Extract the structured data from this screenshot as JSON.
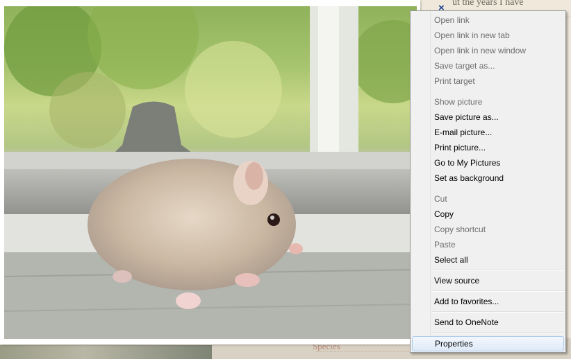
{
  "background_page": {
    "top_text": "ut the years I have",
    "bottom_text": "Species"
  },
  "overlay": {
    "close_icon": "×"
  },
  "context_menu": {
    "items": [
      {
        "label": "Open link",
        "enabled": false
      },
      {
        "label": "Open link in new tab",
        "enabled": false
      },
      {
        "label": "Open link in new window",
        "enabled": false
      },
      {
        "label": "Save target as...",
        "enabled": false
      },
      {
        "label": "Print target",
        "enabled": false
      },
      {
        "separator": true
      },
      {
        "label": "Show picture",
        "enabled": false
      },
      {
        "label": "Save picture as...",
        "enabled": true
      },
      {
        "label": "E-mail picture...",
        "enabled": true
      },
      {
        "label": "Print picture...",
        "enabled": true
      },
      {
        "label": "Go to My Pictures",
        "enabled": true
      },
      {
        "label": "Set as background",
        "enabled": true
      },
      {
        "separator": true
      },
      {
        "label": "Cut",
        "enabled": false
      },
      {
        "label": "Copy",
        "enabled": true
      },
      {
        "label": "Copy shortcut",
        "enabled": false
      },
      {
        "label": "Paste",
        "enabled": false
      },
      {
        "label": "Select all",
        "enabled": true
      },
      {
        "separator": true
      },
      {
        "label": "View source",
        "enabled": true
      },
      {
        "separator": true
      },
      {
        "label": "Add to favorites...",
        "enabled": true
      },
      {
        "separator": true
      },
      {
        "label": "Send to OneNote",
        "enabled": true
      },
      {
        "separator": true
      },
      {
        "label": "Properties",
        "enabled": true,
        "highlighted": true
      }
    ]
  }
}
